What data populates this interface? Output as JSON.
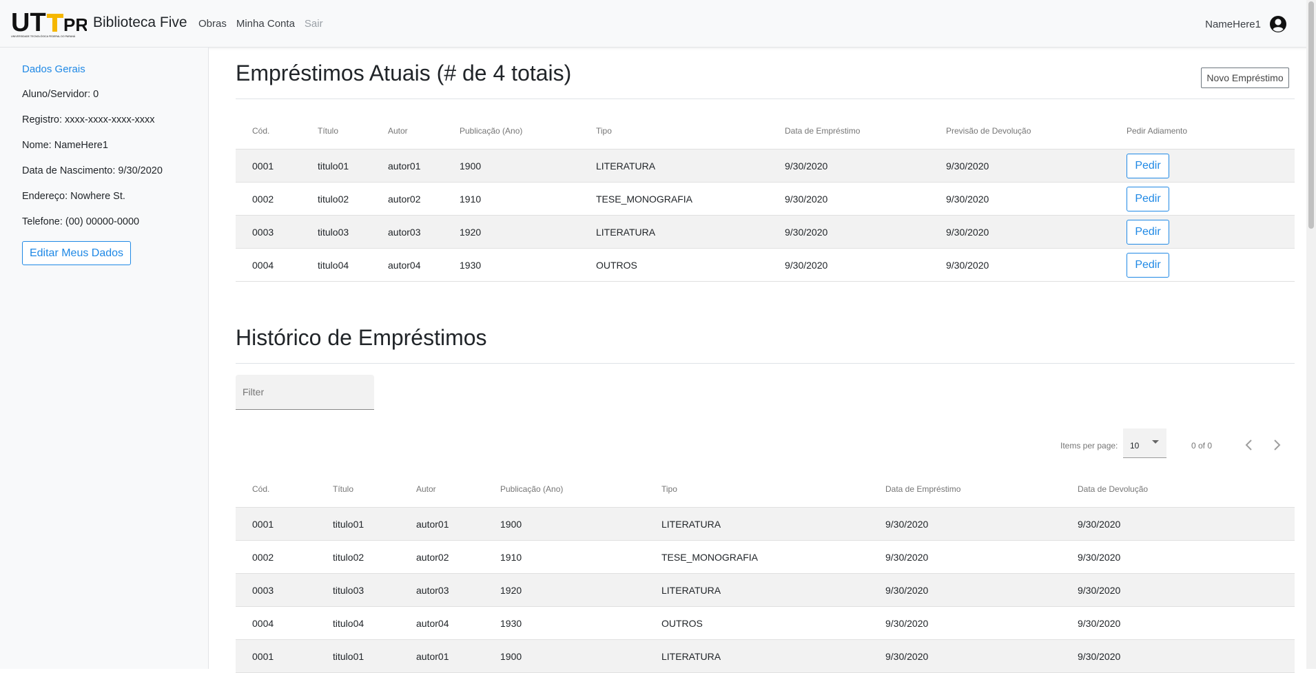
{
  "navbar": {
    "brand": "Biblioteca Five",
    "logo_text": "UTFPR",
    "logo_subtext": "UNIVERSIDADE TECNOLÓGICA FEDERAL DO PARANÁ",
    "links": [
      "Obras",
      "Minha Conta",
      "Sair"
    ],
    "username": "NameHere1"
  },
  "sidebar": {
    "title": "Dados Gerais",
    "fields": [
      "Aluno/Servidor: 0",
      "Registro: xxxx-xxxx-xxxx-xxxx",
      "Nome: NameHere1",
      "Data de Nascimento: 9/30/2020",
      "Endereço: Nowhere St.",
      "Telefone: (00) 00000-0000"
    ],
    "edit_button": "Editar Meus Dados"
  },
  "current_loans": {
    "title": "Empréstimos Atuais (# de 4 totais)",
    "new_loan_button": "Novo Empréstimo",
    "columns": [
      "Cód.",
      "Título",
      "Autor",
      "Publicação (Ano)",
      "Tipo",
      "Data de Empréstimo",
      "Previsão de Devolução",
      "Pedir Adiamento"
    ],
    "action_label": "Pedir",
    "rows": [
      [
        "0001",
        "titulo01",
        "autor01",
        "1900",
        "LITERATURA",
        "9/30/2020",
        "9/30/2020"
      ],
      [
        "0002",
        "titulo02",
        "autor02",
        "1910",
        "TESE_MONOGRAFIA",
        "9/30/2020",
        "9/30/2020"
      ],
      [
        "0003",
        "titulo03",
        "autor03",
        "1920",
        "LITERATURA",
        "9/30/2020",
        "9/30/2020"
      ],
      [
        "0004",
        "titulo04",
        "autor04",
        "1930",
        "OUTROS",
        "9/30/2020",
        "9/30/2020"
      ]
    ]
  },
  "history": {
    "title": "Histórico de Empréstimos",
    "filter_placeholder": "Filter",
    "paginator": {
      "items_per_page_label": "Items per page:",
      "items_per_page": "10",
      "range": "0 of 0"
    },
    "columns": [
      "Cód.",
      "Título",
      "Autor",
      "Publicação (Ano)",
      "Tipo",
      "Data de Empréstimo",
      "Data de Devolução"
    ],
    "rows": [
      [
        "0001",
        "titulo01",
        "autor01",
        "1900",
        "LITERATURA",
        "9/30/2020",
        "9/30/2020"
      ],
      [
        "0002",
        "titulo02",
        "autor02",
        "1910",
        "TESE_MONOGRAFIA",
        "9/30/2020",
        "9/30/2020"
      ],
      [
        "0003",
        "titulo03",
        "autor03",
        "1920",
        "LITERATURA",
        "9/30/2020",
        "9/30/2020"
      ],
      [
        "0004",
        "titulo04",
        "autor04",
        "1930",
        "OUTROS",
        "9/30/2020",
        "9/30/2020"
      ],
      [
        "0001",
        "titulo01",
        "autor01",
        "1900",
        "LITERATURA",
        "9/30/2020",
        "9/30/2020"
      ]
    ]
  },
  "colors": {
    "accent": "#1e88e5",
    "navbar_bg": "#f8f9fa",
    "row_alt": "#f2f2f2"
  }
}
